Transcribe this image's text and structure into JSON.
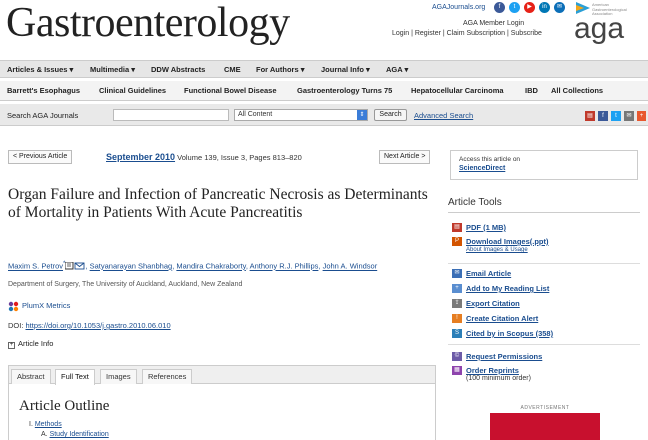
{
  "header": {
    "logo": "Gastroenterology",
    "aga_journals_link": "AGAJournals.org",
    "member_login": "AGA Member Login",
    "login_links": [
      "Login",
      "Register",
      "Claim Subscription",
      "Subscribe"
    ],
    "aga_logo_small": "American Gastroenterological Association",
    "aga_logo_text": "aga",
    "social_icons": [
      "facebook-icon",
      "twitter-icon",
      "youtube-icon",
      "linkedin-icon",
      "email-icon"
    ],
    "colors": {
      "facebook": "#3b5998",
      "twitter": "#1da1f2",
      "youtube": "#e62117",
      "linkedin": "#0077b5",
      "email": "#0c6fb8"
    }
  },
  "nav_primary": [
    {
      "label": "Articles & Issues",
      "caret": "▾"
    },
    {
      "label": "Multimedia",
      "caret": "▾"
    },
    {
      "label": "DDW Abstracts",
      "caret": ""
    },
    {
      "label": "CME",
      "caret": ""
    },
    {
      "label": "For Authors",
      "caret": "▾"
    },
    {
      "label": "Journal Info",
      "caret": "▾"
    },
    {
      "label": "AGA",
      "caret": "▾"
    }
  ],
  "nav_secondary": [
    "Barrett's Esophagus",
    "Clinical Guidelines",
    "Functional Bowel Disease",
    "Gastroenterology Turns 75",
    "Hepatocellular Carcinoma",
    "IBD",
    "All Collections"
  ],
  "search": {
    "label": "Search AGA Journals",
    "input_value": "",
    "scope_selected": "All Content",
    "button_label": "Search",
    "advanced_label": "Advanced Search",
    "share_icons": [
      "pdf-share-icon",
      "facebook-icon",
      "twitter-icon",
      "email-icon",
      "plus-icon"
    ]
  },
  "pager": {
    "prev_label": "< Previous Article",
    "next_label": "Next Article >",
    "issue_date": "September 2010",
    "issue_details": " Volume 139, Issue 3, Pages 813–820"
  },
  "article": {
    "title": "Organ Failure and Infection of Pancreatic Necrosis as Determinants of Mortality in Patients With Acute Pancreatitis",
    "authors": [
      "Maxim S. Petrov",
      "Satyanarayan Shanbhag",
      "Mandira Chakraborty",
      "Anthony R.J. Phillips",
      "John A. Windsor"
    ],
    "corresponding_mark": "*",
    "affiliation": "Department of Surgery, The University of Auckland, Auckland, New Zealand",
    "plumx_label": "PlumX Metrics",
    "doi_label": "DOI: ",
    "doi_link": "https://doi.org/10.1053/j.gastro.2010.06.010",
    "article_info_label": "Article Info",
    "article_info_toggle": "+"
  },
  "tabs": {
    "items": [
      "Abstract",
      "Full Text",
      "Images",
      "References"
    ],
    "active": "Full Text"
  },
  "outline": {
    "title": "Article Outline",
    "item_1_num": "I. ",
    "item_1": "Methods",
    "item_1a_num": "A. ",
    "item_1a": "Study Identification"
  },
  "sidebar": {
    "sd_access": "Access this article on",
    "sd_link": "ScienceDirect",
    "tools_title": "Article Tools",
    "tools": [
      {
        "label": "PDF (1 MB)",
        "icon": "pdf-icon"
      },
      {
        "label": "Download Images(.ppt)",
        "sub": "About Images & Usage",
        "icon": "ppt-icon"
      },
      {
        "label": "Email Article",
        "icon": "email-icon"
      },
      {
        "label": "Add to My Reading List",
        "icon": "reading-list-icon"
      },
      {
        "label": "Export Citation",
        "icon": "export-icon"
      },
      {
        "label": "Create Citation Alert",
        "icon": "alert-icon"
      },
      {
        "label": "Cited by in Scopus (358)",
        "icon": "scopus-icon"
      },
      {
        "label": "Request Permissions",
        "icon": "permissions-icon"
      },
      {
        "label": "Order Reprints",
        "sub_plain": "(100 minimum order)",
        "icon": "reprints-icon"
      }
    ],
    "ad_label": "ADVERTISEMENT"
  }
}
